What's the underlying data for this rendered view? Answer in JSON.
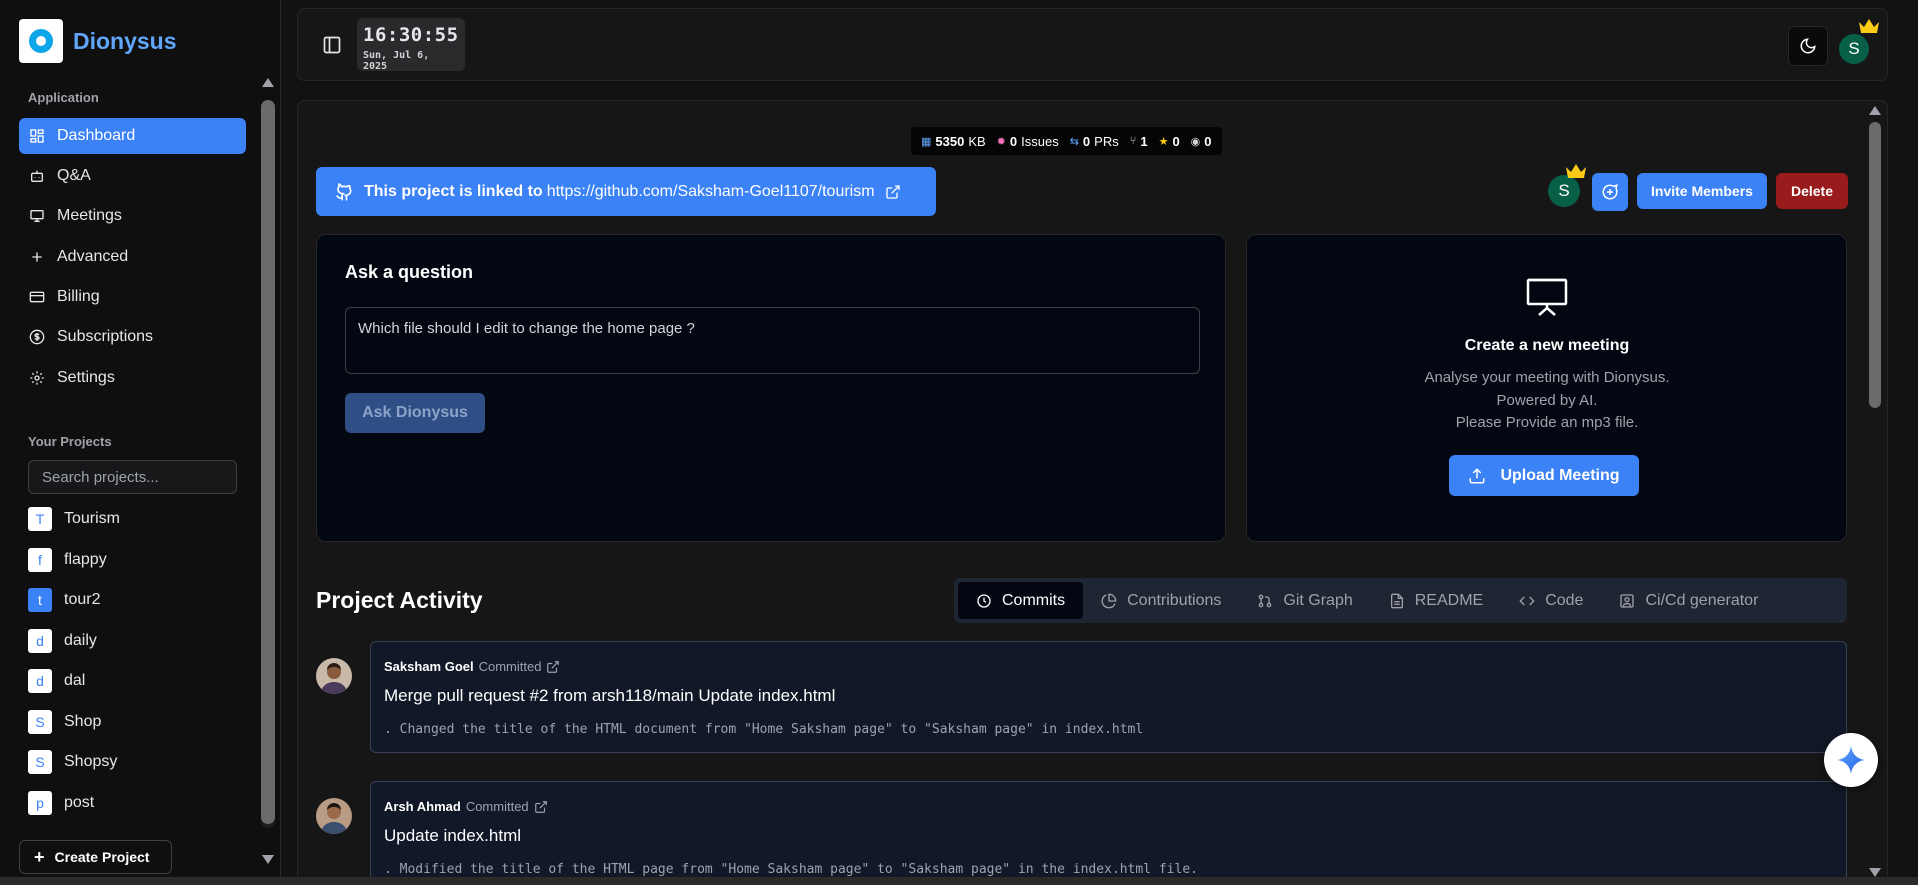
{
  "brand": {
    "name": "Dionysus"
  },
  "sidebar": {
    "group_application": "Application",
    "items": [
      {
        "label": "Dashboard",
        "icon": "dashboard-icon",
        "active": true
      },
      {
        "label": "Q&A",
        "icon": "bot-icon"
      },
      {
        "label": "Meetings",
        "icon": "presentation-icon"
      },
      {
        "label": "Advanced",
        "icon": "plus-icon"
      },
      {
        "label": "Billing",
        "icon": "credit-card-icon"
      },
      {
        "label": "Subscriptions",
        "icon": "dollar-circle-icon"
      },
      {
        "label": "Settings",
        "icon": "gear-icon"
      }
    ],
    "group_projects": "Your Projects",
    "search_placeholder": "Search projects...",
    "projects": [
      {
        "letter": "T",
        "name": "Tourism"
      },
      {
        "letter": "f",
        "name": "flappy"
      },
      {
        "letter": "t",
        "name": "tour2",
        "active": true
      },
      {
        "letter": "d",
        "name": "daily"
      },
      {
        "letter": "d",
        "name": "dal"
      },
      {
        "letter": "S",
        "name": "Shop"
      },
      {
        "letter": "S",
        "name": "Shopsy"
      },
      {
        "letter": "p",
        "name": "post"
      }
    ],
    "create_label": "Create Project"
  },
  "topbar": {
    "time": "16:30:55",
    "date": "Sun, Jul 6, 2025",
    "avatar_letter": "S"
  },
  "stats": {
    "size": "5350",
    "size_unit": "KB",
    "issues": "0",
    "issues_label": "Issues",
    "prs": "0",
    "prs_label": "PRs",
    "forks": "1",
    "stars": "0",
    "watchers": "0"
  },
  "banner": {
    "text": "This project is linked to",
    "url": "https://github.com/Saksham-Goel1107/tourism"
  },
  "actions": {
    "avatar_letter": "S",
    "invite_label": "Invite Members",
    "delete_label": "Delete"
  },
  "ask": {
    "title": "Ask a question",
    "value": "Which file should I edit to change the home page ?",
    "button": "Ask Dionysus"
  },
  "meeting": {
    "title": "Create a new meeting",
    "line1": "Analyse your meeting with Dionysus.",
    "line2": "Powered by AI.",
    "line3": "Please Provide an mp3 file.",
    "button": "Upload Meeting"
  },
  "activity": {
    "title": "Project Activity",
    "tabs": [
      {
        "label": "Commits",
        "active": true
      },
      {
        "label": "Contributions"
      },
      {
        "label": "Git Graph"
      },
      {
        "label": "README"
      },
      {
        "label": "Code"
      },
      {
        "label": "Ci/Cd generator"
      }
    ],
    "commits": [
      {
        "author": "Saksham Goel",
        "verb": "Committed",
        "message": "Merge pull request #2 from arsh118/main Update index.html",
        "summary": ". Changed the title of the HTML document from \"Home Saksham page\" to \"Saksham page\" in index.html"
      },
      {
        "author": "Arsh Ahmad",
        "verb": "Committed",
        "message": "Update index.html",
        "summary": ". Modified the title of the HTML page from \"Home Saksham page\" to \"Saksham page\" in the index.html file."
      }
    ]
  }
}
